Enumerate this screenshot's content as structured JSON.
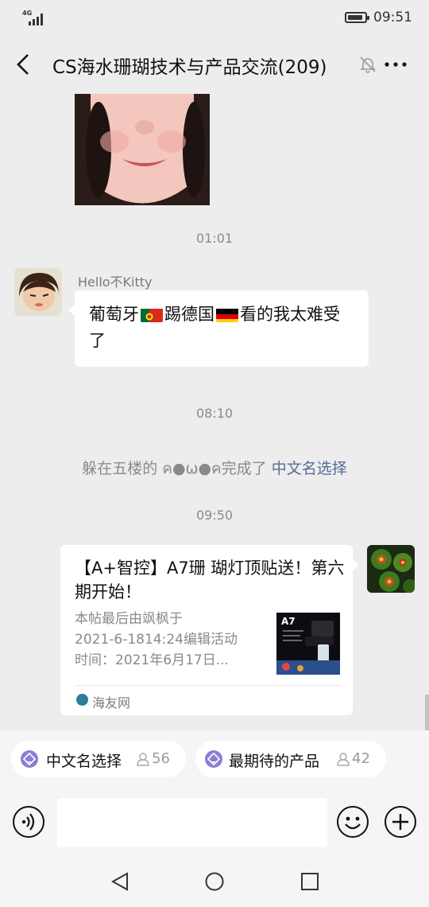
{
  "status_bar": {
    "network": "4G",
    "time": "09:51",
    "battery_level": 0.9
  },
  "header": {
    "back_icon": "back-arrow-icon",
    "title": "CS海水珊瑚技术与产品交流(209)",
    "mute_icon": "mute-bell-icon",
    "more_icon": "more-icon"
  },
  "messages": {
    "ts1": "01:01",
    "msg1": {
      "sender": "Hello不Kitty",
      "text_1": "葡萄牙",
      "text_2": "踢德国",
      "text_3": "看的我太难受了"
    },
    "ts2": "08:10",
    "sys": {
      "prefix": "躲在五楼的 ค●ω●ค完成了 ",
      "link": "中文名选择"
    },
    "ts3": "09:50",
    "card": {
      "title": "【A+智控】A7珊 瑚灯顶贴送！第六期开始！",
      "desc_line1": "本帖最后由飒枫于",
      "desc_line2": "2021-6-1814:24编辑活动",
      "desc_line3": "时间：2021年6月17日...",
      "thumb_text": "A7",
      "source": "海友网"
    }
  },
  "topics": [
    {
      "label": "中文名选择",
      "count": "56"
    },
    {
      "label": "最期待的产品",
      "count": "42"
    }
  ],
  "input": {
    "voice_icon": "voice-icon",
    "emoji_icon": "emoji-icon",
    "plus_icon": "plus-icon"
  },
  "nav": {
    "back_icon": "nav-back-icon",
    "home_icon": "nav-home-icon",
    "recent_icon": "nav-recent-icon"
  }
}
